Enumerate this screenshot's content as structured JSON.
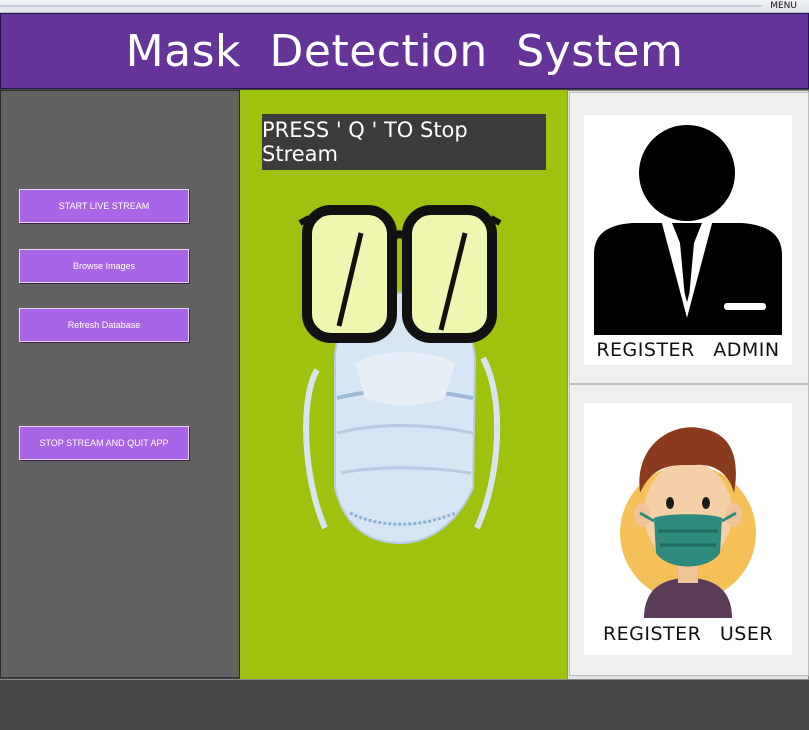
{
  "window": {
    "menu_label": "MENU"
  },
  "header": {
    "title": "Mask Detection System"
  },
  "left_panel": {
    "buttons": [
      {
        "label": "START LIVE STREAM"
      },
      {
        "label": "Browse Images"
      },
      {
        "label": "Refresh Database"
      },
      {
        "label": "STOP STREAM AND QUIT APP"
      }
    ]
  },
  "center_panel": {
    "instruction": "PRESS ' Q ' TO Stop Stream"
  },
  "right_panel": {
    "admin_label": "REGISTER ADMIN",
    "user_label": "REGISTER USER"
  },
  "colors": {
    "header_bg": "#653499",
    "button_bg": "#a865e6",
    "center_bg": "#9fc20f",
    "left_bg": "#626262"
  }
}
